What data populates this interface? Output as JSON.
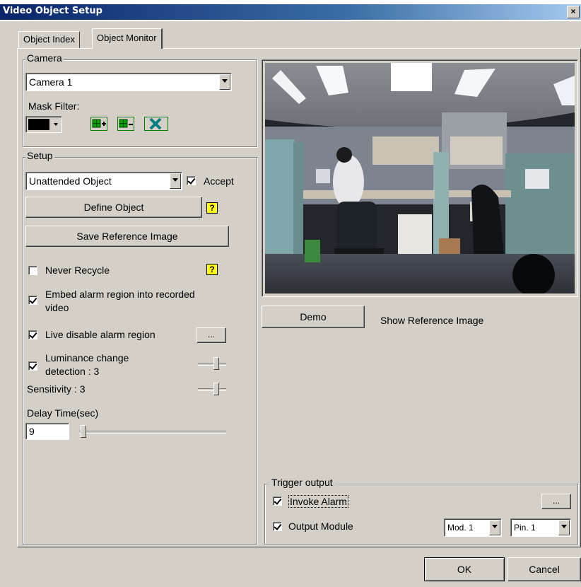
{
  "window": {
    "title": "Video Object Setup",
    "close_label": "×"
  },
  "tabs": [
    {
      "label": "Object Index",
      "active": false
    },
    {
      "label": "Object Monitor",
      "active": true
    }
  ],
  "camera": {
    "group_label": "Camera",
    "selected": "Camera 1",
    "mask_filter_label": "Mask Filter:",
    "mask_color": "#000000"
  },
  "setup": {
    "group_label": "Setup",
    "mode": "Unattended Object",
    "accept_label": "Accept",
    "accept_checked": true,
    "define_object_label": "Define Object",
    "save_reference_label": "Save Reference Image",
    "help_glyph": "?",
    "never_recycle_label": "Never Recycle",
    "never_recycle_checked": false,
    "embed_label_line1": "Embed alarm region into recorded",
    "embed_label_line2": "video",
    "embed_checked": true,
    "live_disable_label": "Live disable alarm region",
    "live_disable_checked": true,
    "ellipsis": "...",
    "luminance_line1": "Luminance change",
    "luminance_line2": "detection : 3",
    "luminance_checked": true,
    "sensitivity_label": "Sensitivity : 3",
    "delay_label": "Delay Time(sec)",
    "delay_value": "9"
  },
  "preview": {
    "demo_label": "Demo",
    "show_reference_label": "Show Reference Image"
  },
  "trigger": {
    "group_label": "Trigger output",
    "invoke_alarm_label": "Invoke Alarm",
    "invoke_alarm_checked": true,
    "output_module_label": "Output Module",
    "output_module_checked": true,
    "ellipsis": "...",
    "module": "Mod. 1",
    "pin": "Pin. 1"
  },
  "footer": {
    "ok_label": "OK",
    "cancel_label": "Cancel"
  }
}
